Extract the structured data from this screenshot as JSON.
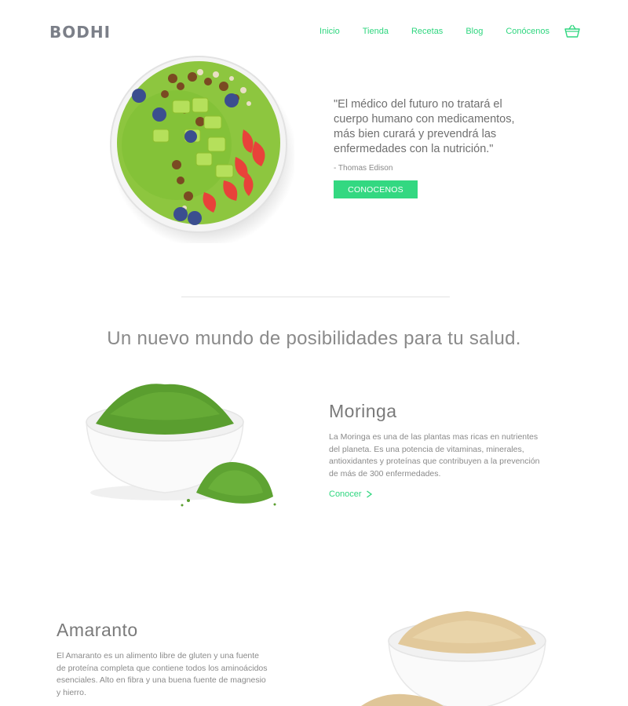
{
  "brand": {
    "logo": "BODHI"
  },
  "nav": {
    "items": [
      {
        "label": "Inicio"
      },
      {
        "label": "Tienda"
      },
      {
        "label": "Recetas"
      },
      {
        "label": "Blog"
      },
      {
        "label": "Conócenos"
      }
    ],
    "cart_icon": "basket-icon"
  },
  "hero": {
    "image_icon": "smoothie-bowl-image",
    "quote": "\"El médico del futuro no tratará el cuerpo humano con medicamentos, más bien curará y prevendrá las enfermedades con la nutrición.\"",
    "author": "- Thomas Edison",
    "cta_label": "CONOCENOS"
  },
  "intro": {
    "title": "Un nuevo mundo de posibilidades para tu salud."
  },
  "products": [
    {
      "title": "Moringa",
      "description": "La Moringa es una de las plantas mas ricas en nutrientes del planeta. Es una potencia de vitaminas, minerales, antioxidantes y proteínas que contribuyen a la prevención de más de 300 enfermedades.",
      "link_label": "Conocer",
      "image_icon": "moringa-powder-bowl-image"
    },
    {
      "title": "Amaranto",
      "description": "El Amaranto es un alimento libre de gluten y una fuente de proteína completa que contiene todos los aminoácidos esenciales. Alto en fibra y una buena fuente de magnesio y hierro.",
      "image_icon": "amaranth-bowl-image"
    }
  ],
  "colors": {
    "accent": "#33d881",
    "logo": "#7b7f88",
    "text": "#8a8a8a"
  }
}
